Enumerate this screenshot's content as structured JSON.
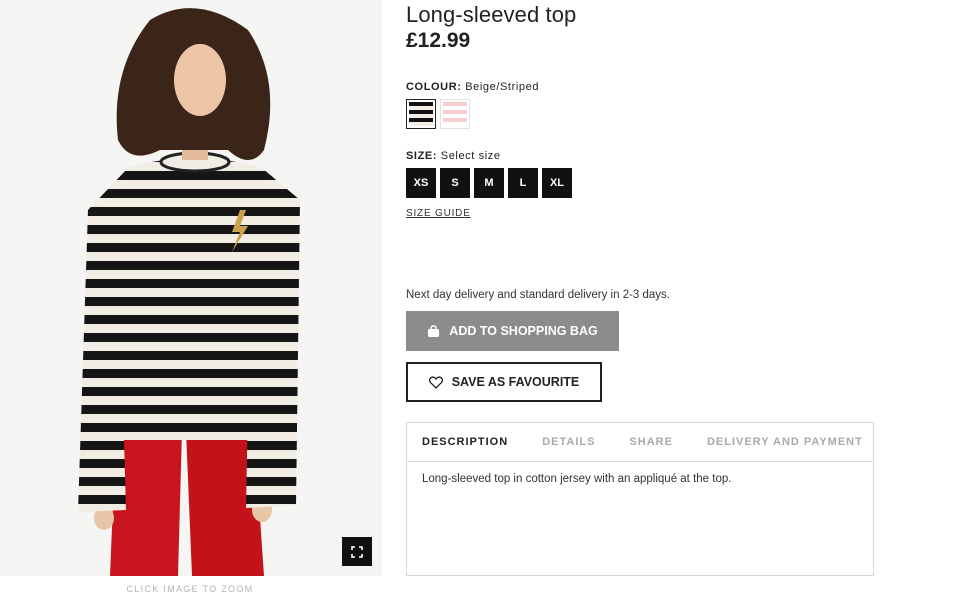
{
  "product": {
    "title": "Long-sleeved top",
    "price": "£12.99"
  },
  "image": {
    "zoom_caption": "CLICK IMAGE TO ZOOM",
    "zoom_icon": "expand-icon"
  },
  "colour": {
    "label": "COLOUR:",
    "selected": "Beige/Striped",
    "swatches": [
      {
        "name": "Beige/Striped",
        "colors": [
          "#111111",
          "#f3eee6"
        ]
      },
      {
        "name": "Pink/Striped",
        "colors": [
          "#f7cfcf",
          "#ffffff"
        ]
      }
    ]
  },
  "size": {
    "label": "SIZE:",
    "prompt": "Select size",
    "options": [
      "XS",
      "S",
      "M",
      "L",
      "XL"
    ],
    "guide": "SIZE GUIDE"
  },
  "delivery_note": "Next day delivery and standard delivery in 2-3 days.",
  "actions": {
    "add_to_bag": "ADD TO SHOPPING BAG",
    "add_to_bag_icon": "shopping-bag-icon",
    "favourite": "SAVE AS FAVOURITE",
    "favourite_icon": "heart-icon"
  },
  "tabs": {
    "items": [
      "DESCRIPTION",
      "DETAILS",
      "SHARE",
      "DELIVERY AND PAYMENT"
    ],
    "active": "DESCRIPTION",
    "content": "Long-sleeved top in cotton jersey with an appliqué at the top."
  },
  "colors": {
    "button_grey": "#8c8c8c",
    "dark": "#111111",
    "trouser_red": "#c8141c"
  }
}
